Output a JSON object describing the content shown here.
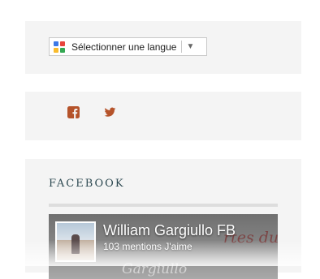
{
  "translate": {
    "label": "Sélectionner une langue",
    "arrow": "▼",
    "logo_icon": "google-translate-icon"
  },
  "social": {
    "icons": [
      "facebook-icon",
      "twitter-icon"
    ],
    "icon_color": "#b5532a"
  },
  "facebook_widget": {
    "title": "FACEBOOK",
    "page_name": "William Gargiullo FB",
    "likes": "103 mentions J'aime"
  },
  "colors": {
    "widget_bg": "#f4f4f4",
    "title_color": "#2e4a52"
  }
}
